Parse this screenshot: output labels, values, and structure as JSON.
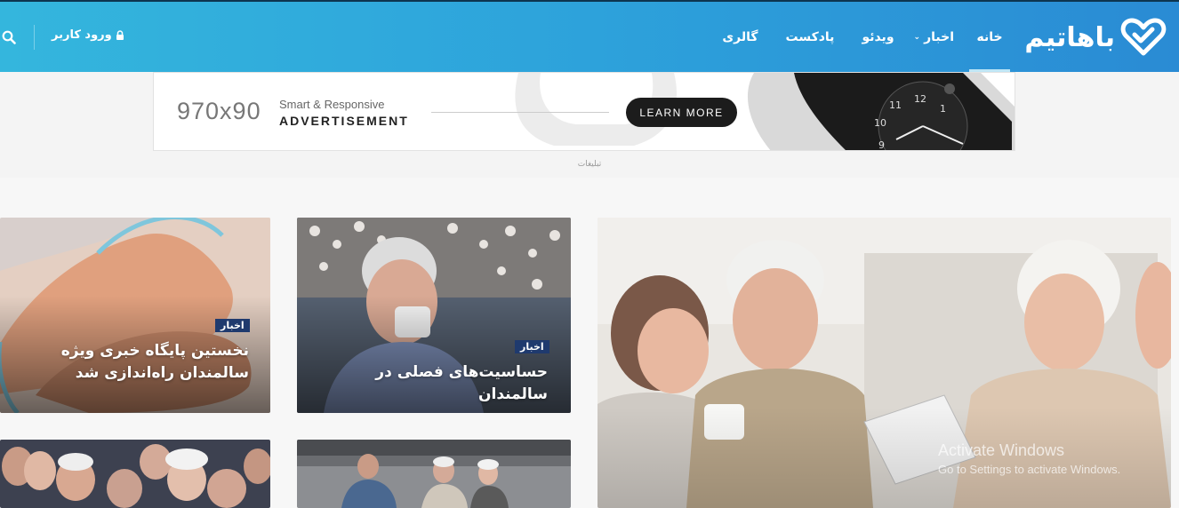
{
  "header": {
    "logo_text": "باهاتیم",
    "nav": [
      {
        "label": "خانه",
        "active": true
      },
      {
        "label": "اخبار",
        "has_dropdown": true
      },
      {
        "label": "ویدئو"
      },
      {
        "label": "پادکست"
      },
      {
        "label": "گالری"
      }
    ],
    "login_label": "ورود کاربر",
    "icons": [
      "logo-heart-icon",
      "lock-icon",
      "search-icon",
      "chevron-down-icon"
    ],
    "colors": {
      "gradient_start": "#34b6dd",
      "gradient_end": "#2a8bd4",
      "topline": "#0d3550"
    }
  },
  "ad": {
    "size_text": "970x90",
    "line1": "Smart & Responsive",
    "line2": "ADVERTISEMENT",
    "button_label": "LEARN MORE",
    "caption": "تبلیغات"
  },
  "cards": [
    {
      "badge": "اخبار",
      "title": "نخستین پایگاه خبری ویژه سالمندان راه‌اندازی شد"
    },
    {
      "badge": "اخبار",
      "title": "حساسیت‌های فصلی در سالمندان"
    },
    {
      "badge": "",
      "title": ""
    },
    {
      "badge": "",
      "title": ""
    },
    {
      "badge": "",
      "title": ""
    }
  ],
  "system": {
    "watermark_line1": "Activate Windows",
    "watermark_line2": "Go to Settings to activate Windows."
  },
  "badge_color": "#1f3a6e"
}
